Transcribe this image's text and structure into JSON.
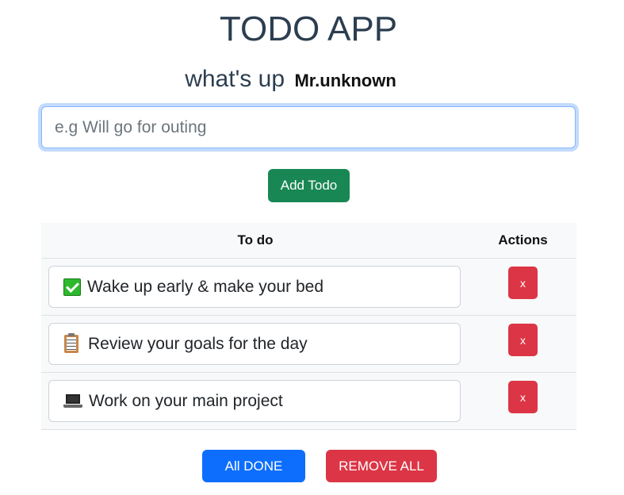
{
  "app": {
    "title": "TODO APP",
    "greeting_prefix": "what's up",
    "user_name": "Mr.unknown"
  },
  "input": {
    "placeholder": "e.g Will go for outing",
    "value": ""
  },
  "buttons": {
    "add_label": "Add Todo",
    "delete_label": "x",
    "all_done_label": "All DONE",
    "remove_all_label": "REMOVE ALL"
  },
  "table": {
    "headers": {
      "todo": "To do",
      "actions": "Actions"
    },
    "rows": [
      {
        "icon": "check-mark-icon",
        "text": "Wake up early & make your bed"
      },
      {
        "icon": "clipboard-icon",
        "text": "Review your goals for the day"
      },
      {
        "icon": "laptop-icon",
        "text": "Work on your main project"
      }
    ]
  },
  "colors": {
    "title": "#2c3e50",
    "add_button": "#198754",
    "delete_button": "#dc3545",
    "all_done_button": "#0d6efd",
    "remove_all_button": "#dc3545",
    "input_focus_border": "#86b7fe",
    "table_background": "#f8f9fa"
  }
}
